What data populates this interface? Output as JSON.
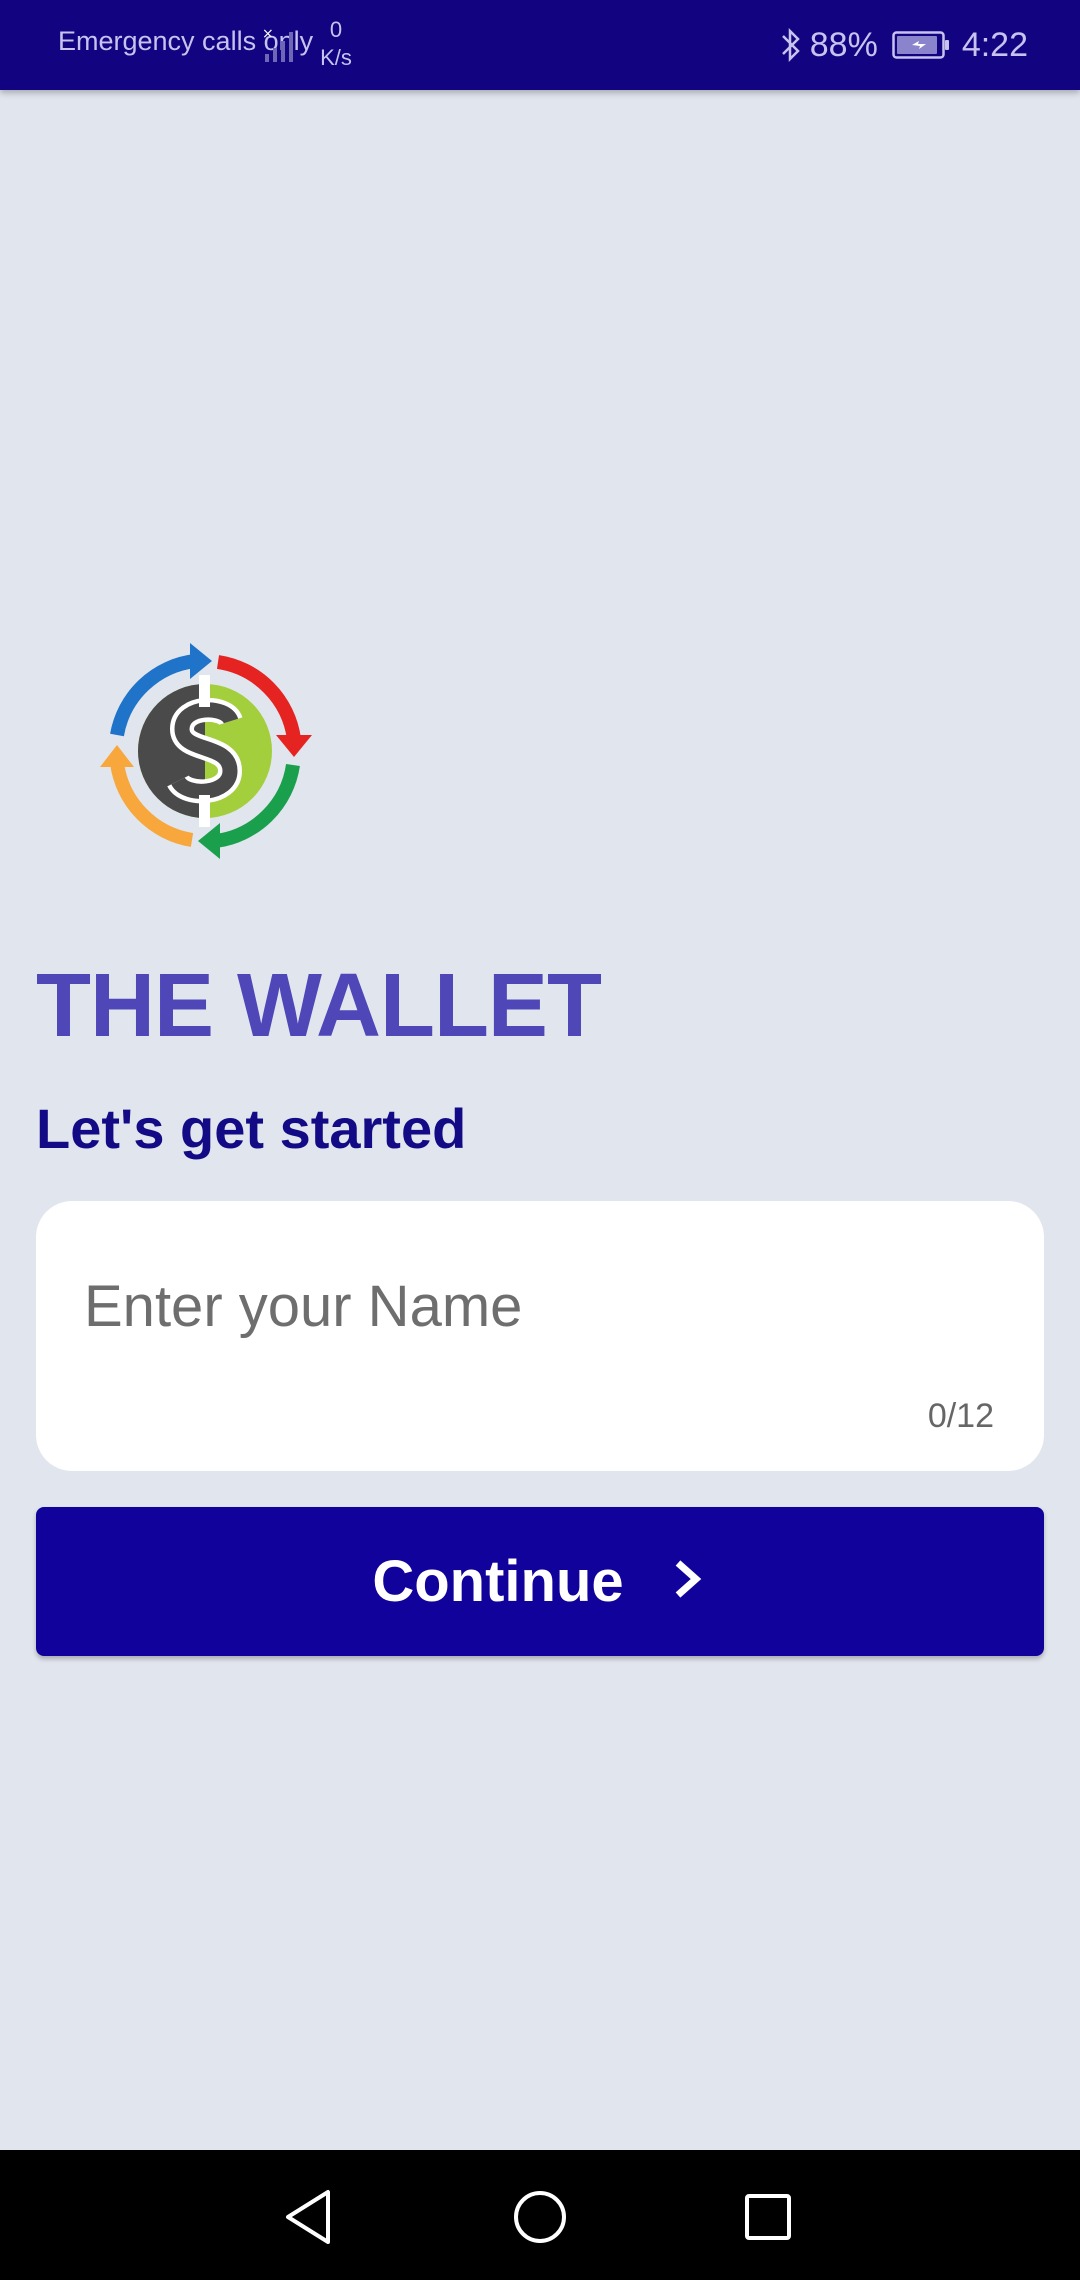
{
  "status_bar": {
    "carrier_text": "Emergency calls only",
    "net_speed_value": "0",
    "net_speed_unit": "K/s",
    "battery_percent": "88%",
    "time": "4:22",
    "icons": [
      "signal-icon",
      "bluetooth-icon",
      "battery-icon"
    ]
  },
  "app": {
    "title": "THE WALLET",
    "subtitle": "Let's get started",
    "logo_icon": "wallet-dollar-cycle-logo"
  },
  "name_field": {
    "placeholder": "Enter your Name",
    "value": "",
    "counter": "0/12"
  },
  "continue_button": {
    "label": "Continue",
    "icon": "chevron-right-icon"
  },
  "navigation": {
    "back": "back-icon",
    "home": "home-icon",
    "recents": "recents-icon"
  },
  "colors": {
    "primary": "#12029c",
    "title": "#4f46b8",
    "status_bar": "#120480",
    "background": "#e1e5ee"
  }
}
